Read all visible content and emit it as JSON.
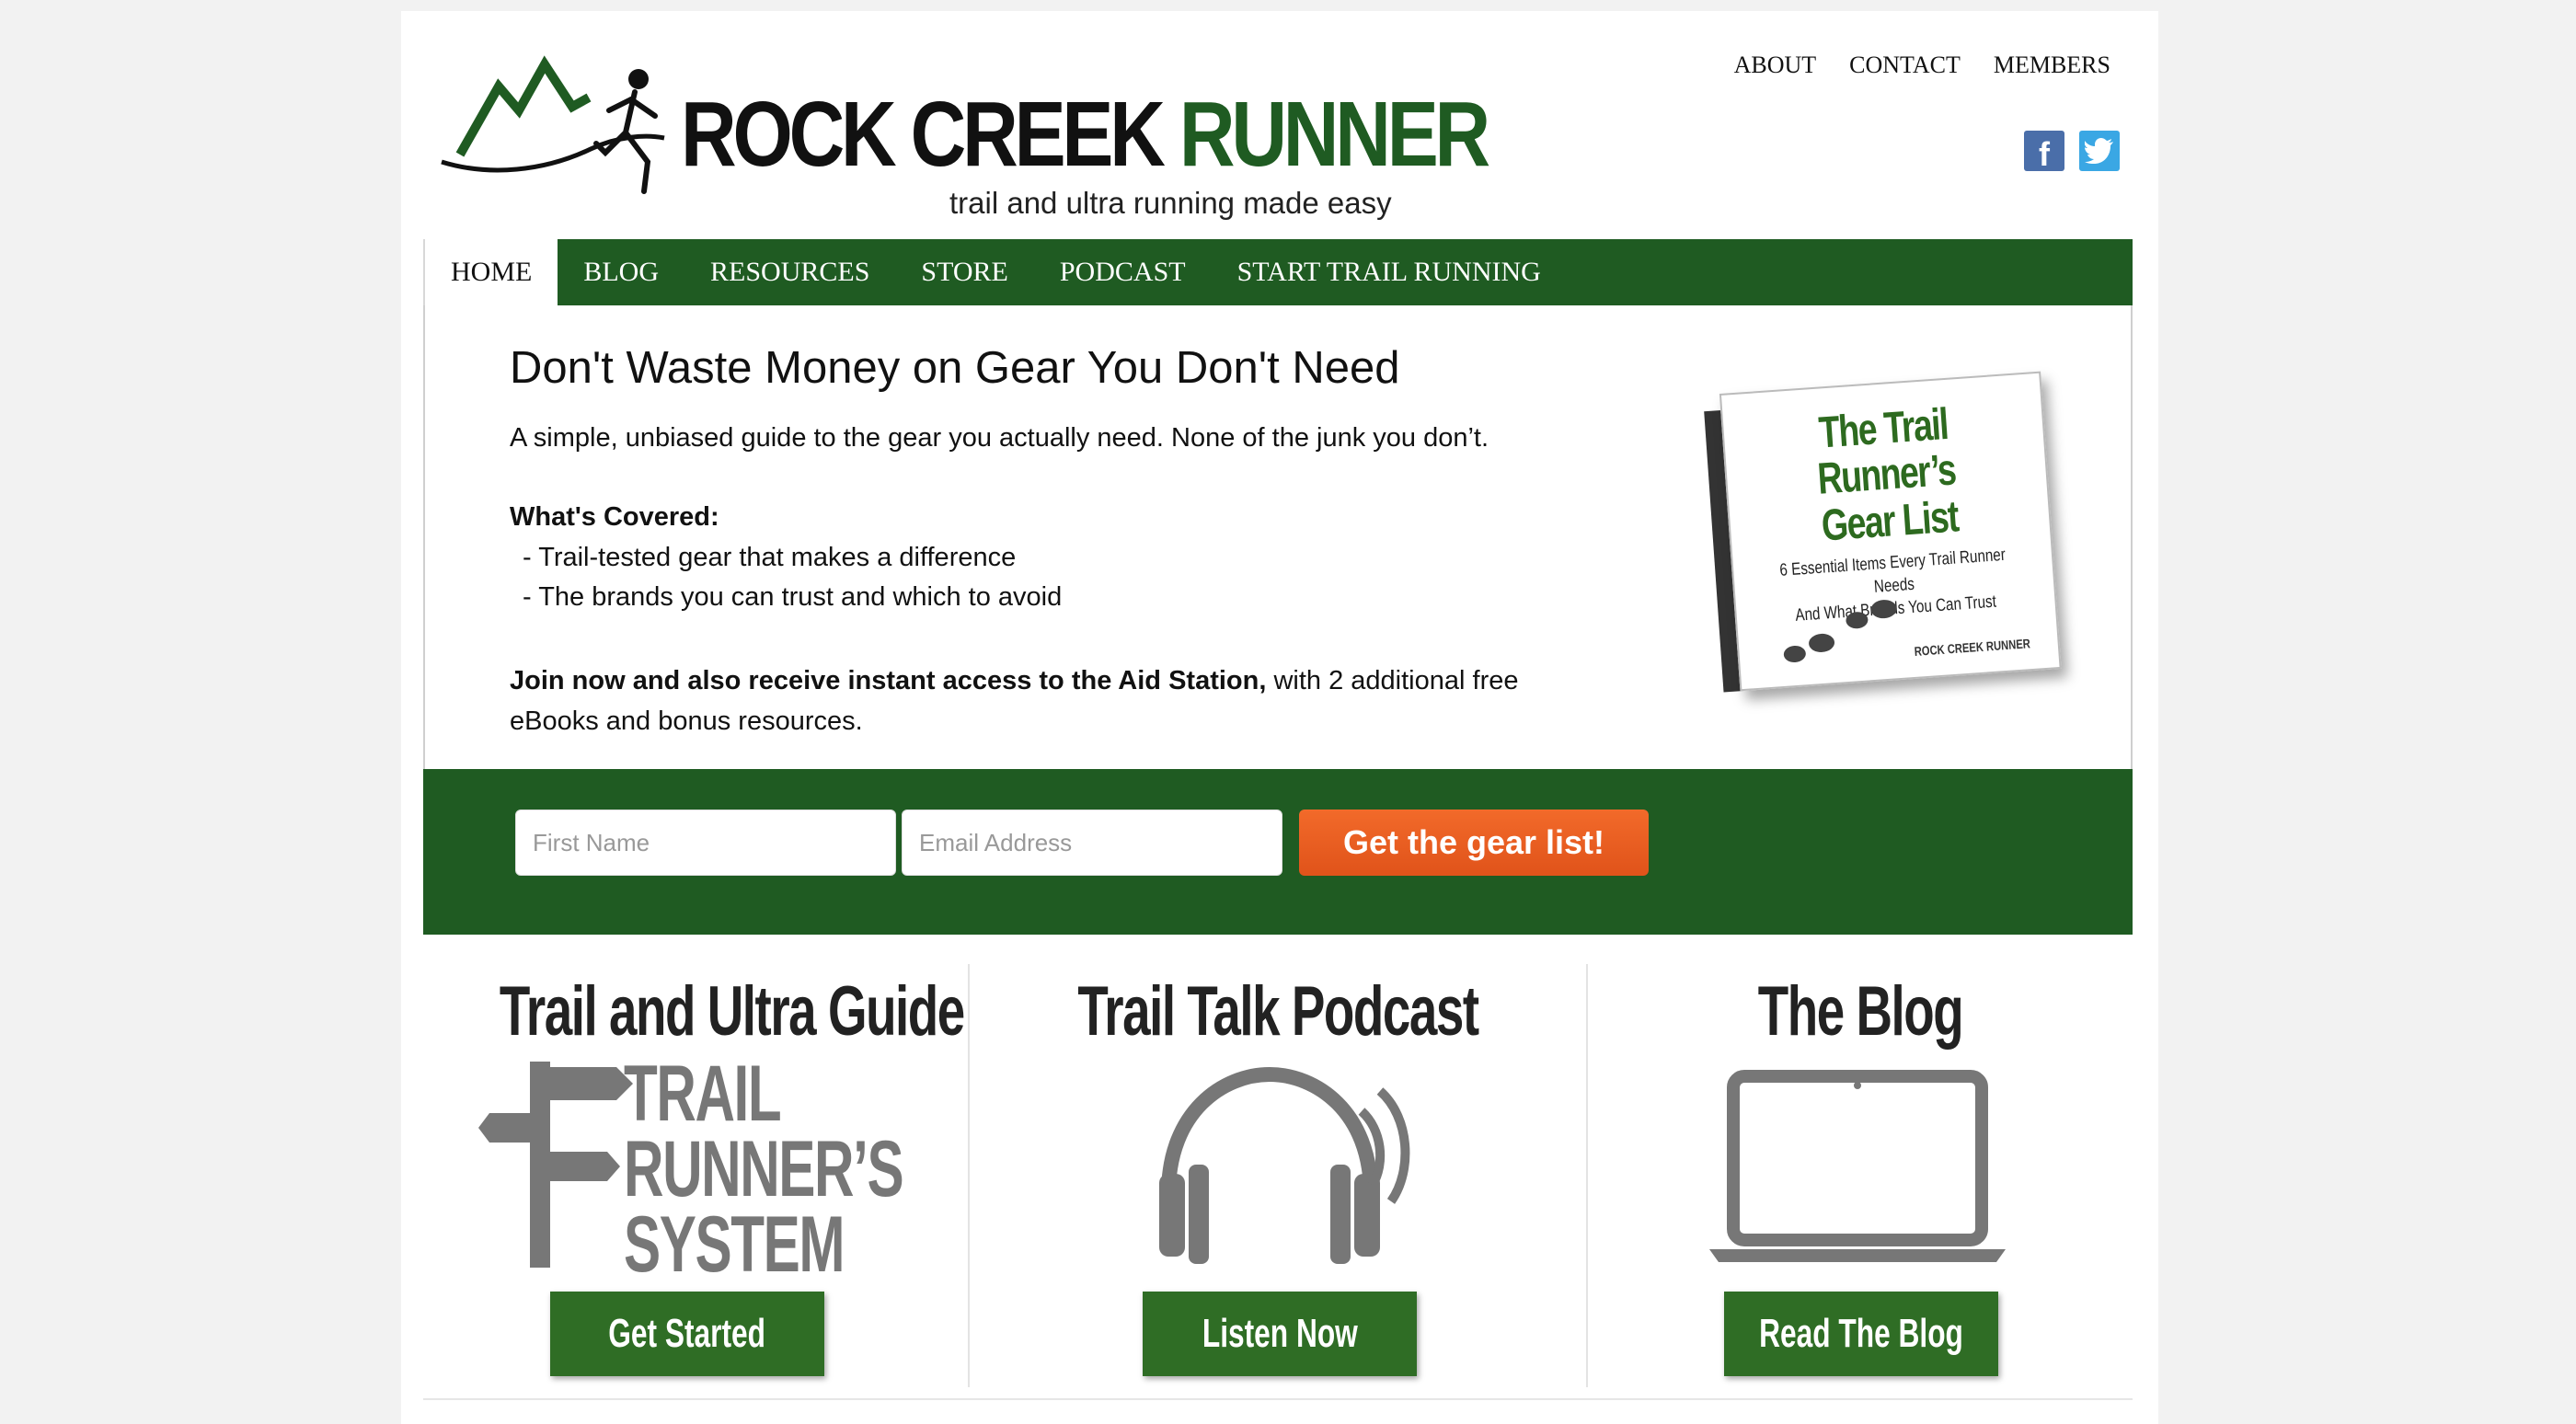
{
  "header": {
    "logo_title_dark": "ROCK CREEK ",
    "logo_title_green": "RUNNER",
    "tagline": "trail and ultra running made easy",
    "top_links": [
      "ABOUT",
      "CONTACT",
      "MEMBERS"
    ],
    "social": {
      "facebook": "f",
      "twitter_icon": "twitter-bird"
    }
  },
  "nav": {
    "items": [
      "HOME",
      "BLOG",
      "RESOURCES",
      "STORE",
      "PODCAST",
      "START TRAIL RUNNING"
    ],
    "active": "HOME"
  },
  "optin": {
    "title": "Don't Waste Money on Gear You Don't Need",
    "subtitle": "A simple, unbiased guide to the gear you actually need. None of the junk you don’t.",
    "covered_heading": "What's Covered:",
    "covered_items": [
      "- Trail-tested gear that makes a difference",
      "- The brands you can trust and which to avoid"
    ],
    "join_bold": "Join now and also receive instant access to the Aid Station,",
    "join_rest": " with 2 additional free eBooks and bonus resources.",
    "book": {
      "title_line1": "The Trail Runner’s",
      "title_line2": "Gear List",
      "subtitle_line1": "6 Essential Items Every Trail Runner Needs",
      "subtitle_line2": "And What Brands You Can Trust",
      "brand": "ROCK CREEK RUNNER"
    }
  },
  "form": {
    "first_name_placeholder": "First Name",
    "email_placeholder": "Email Address",
    "submit_label": "Get the gear list!"
  },
  "columns": [
    {
      "title": "Trail and Ultra Guide",
      "icon": "signpost-icon",
      "icon_text": [
        "TRAIL",
        "RUNNER’S",
        "SYSTEM"
      ],
      "button": "Get Started"
    },
    {
      "title": "Trail Talk Podcast",
      "icon": "headphones-icon",
      "button": "Listen Now"
    },
    {
      "title": "The Blog",
      "icon": "laptop-icon",
      "button": "Read The Blog"
    }
  ],
  "colors": {
    "brand_green": "#1f5b22",
    "cta_orange": "#ea5b1c",
    "button_green": "#2f6d25"
  }
}
